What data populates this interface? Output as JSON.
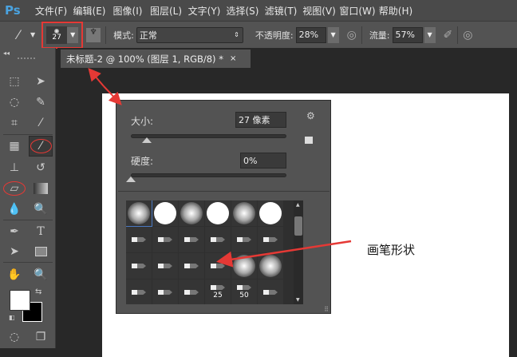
{
  "app": {
    "logo": "Ps"
  },
  "menu": [
    "文件(F)",
    "编辑(E)",
    "图像(I)",
    "图层(L)",
    "文字(Y)",
    "选择(S)",
    "滤镜(T)",
    "视图(V)",
    "窗口(W)",
    "帮助(H)"
  ],
  "options": {
    "brush_size": "27",
    "mode_label": "模式:",
    "mode_value": "正常",
    "opacity_label": "不透明度:",
    "opacity_value": "28%",
    "flow_label": "流量:",
    "flow_value": "57%"
  },
  "document_tab": {
    "title": "未标题-2 @ 100% (图层 1, RGB/8) *",
    "close": "×"
  },
  "brush_panel": {
    "size_label": "大小:",
    "size_value": "27 像素",
    "size_fraction": 0.1,
    "hardness_label": "硬度:",
    "hardness_value": "0%",
    "hardness_fraction": 0.0,
    "presets": [
      {
        "kind": "soft"
      },
      {
        "kind": "hard"
      },
      {
        "kind": "soft"
      },
      {
        "kind": "hard"
      },
      {
        "kind": "soft"
      },
      {
        "kind": "hard"
      },
      {
        "kind": "tip"
      },
      {
        "kind": "tip"
      },
      {
        "kind": "tip"
      },
      {
        "kind": "tip"
      },
      {
        "kind": "tip"
      },
      {
        "kind": "tip"
      },
      {
        "kind": "tip"
      },
      {
        "kind": "tip"
      },
      {
        "kind": "tip"
      },
      {
        "kind": "tip"
      },
      {
        "kind": "soft"
      },
      {
        "kind": "soft"
      },
      {
        "kind": "tip"
      },
      {
        "kind": "tip"
      },
      {
        "kind": "tip"
      },
      {
        "kind": "tip",
        "label": "25"
      },
      {
        "kind": "tip",
        "label": "50"
      },
      {
        "kind": "tip"
      }
    ]
  },
  "annotation": "画笔形状",
  "colors": {
    "highlight": "#e53935",
    "foreground": "#ffffff",
    "background": "#000000"
  }
}
